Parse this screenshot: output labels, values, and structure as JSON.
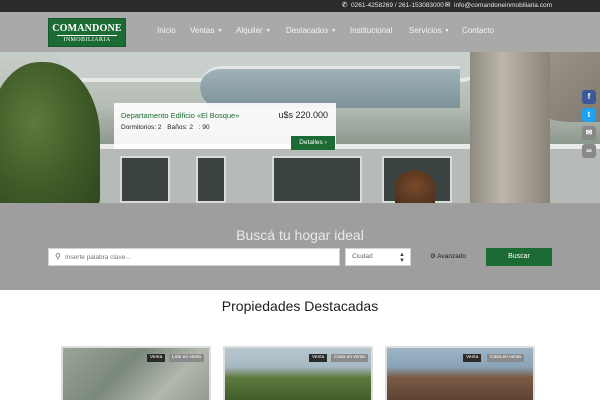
{
  "topbar": {
    "phone": "0261-4258269 / 261-153083000",
    "email": "info@comandoneinmobiliaria.com"
  },
  "logo": {
    "line1": "COMANDONE",
    "line2": "INMOBILIARIA"
  },
  "nav": {
    "items": [
      {
        "label": "Inicio",
        "dropdown": false
      },
      {
        "label": "Ventas",
        "dropdown": true
      },
      {
        "label": "Alquiler",
        "dropdown": true
      },
      {
        "label": "Destacados",
        "dropdown": true
      },
      {
        "label": "Institucional",
        "dropdown": false
      },
      {
        "label": "Servicios",
        "dropdown": true
      },
      {
        "label": "Contacto",
        "dropdown": false
      }
    ]
  },
  "hero_card": {
    "title": "Departamento Edificio «El Bosque»",
    "price": "u$s 220.000",
    "bedrooms": "Dormitorios: 2",
    "bathrooms": "Baños: 2",
    "area": ": 90",
    "button": "Detalles"
  },
  "share": {
    "items": [
      "Facebook",
      "Twitter",
      "Email",
      "Copy Link"
    ]
  },
  "search": {
    "heading": "Buscá tu hogar ideal",
    "placeholder": "Inserte palabra clave...",
    "city": "Ciudad",
    "advanced": "Avanzado",
    "submit": "Buscar"
  },
  "featured": {
    "heading": "Propiedades Destacadas",
    "properties": [
      {
        "status": "Venta",
        "type": "Lote en venta"
      },
      {
        "status": "Venta",
        "type": "Casa en venta"
      },
      {
        "status": "Venta",
        "type": "Casa en venta"
      }
    ]
  },
  "colors": {
    "brand_green": "#1d6b34",
    "header_gray": "#a9a9a9",
    "search_gray": "#9e9e9e",
    "topbar": "#2b2b2b"
  }
}
